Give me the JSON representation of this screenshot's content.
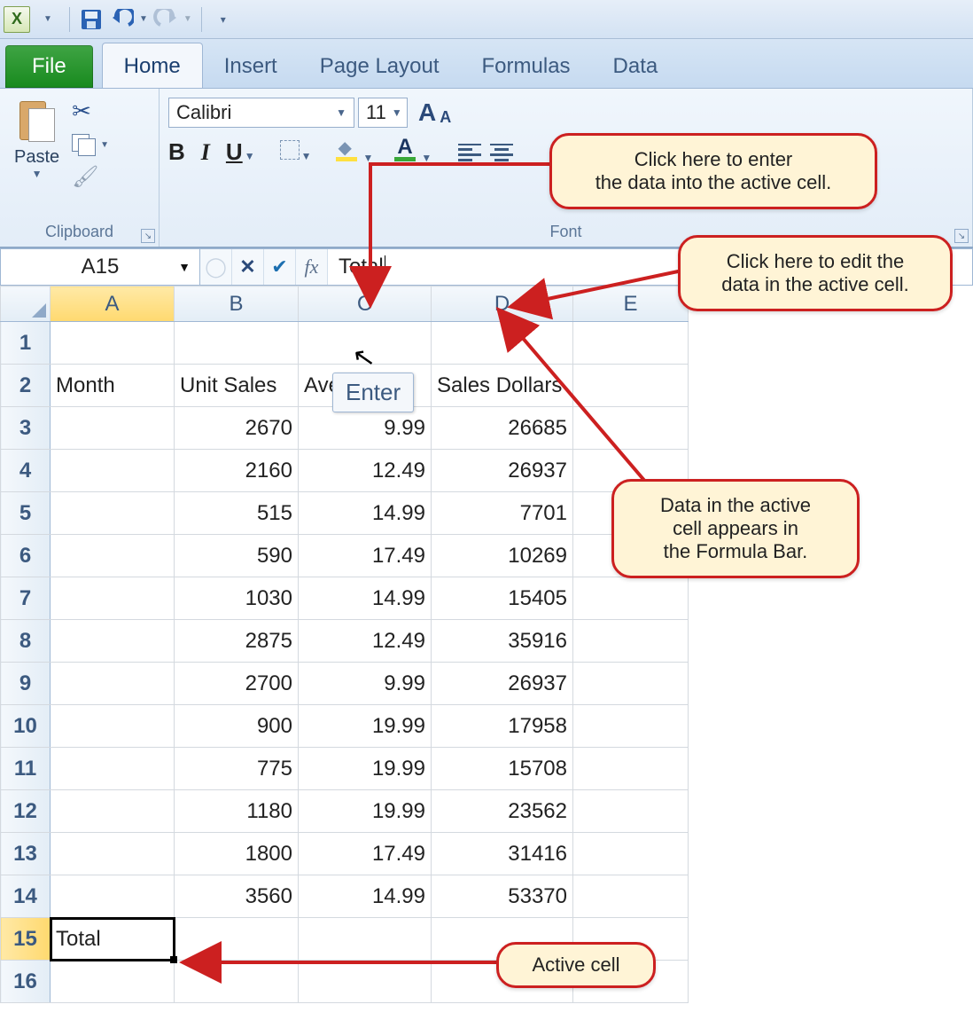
{
  "qat": {
    "app_letter": "X"
  },
  "tabs": {
    "file": "File",
    "items": [
      "Home",
      "Insert",
      "Page Layout",
      "Formulas",
      "Data"
    ],
    "active_index": 0
  },
  "ribbon": {
    "clipboard": {
      "paste": "Paste",
      "group": "Clipboard"
    },
    "font": {
      "name": "Calibri",
      "size": "11",
      "group": "Font",
      "bold": "B",
      "italic": "I",
      "underline": "U"
    }
  },
  "formula_bar": {
    "name_box": "A15",
    "content": "Total",
    "fx": "fx"
  },
  "enter_tooltip": "Enter",
  "columns": [
    "A",
    "B",
    "C",
    "D",
    "E"
  ],
  "row_headers": [
    1,
    2,
    3,
    4,
    5,
    6,
    7,
    8,
    9,
    10,
    11,
    12,
    13,
    14,
    15,
    16
  ],
  "headers_row": {
    "A": "Month",
    "B": "Unit Sales",
    "C": "Average P",
    "D": "Sales Dollars"
  },
  "data_rows": [
    {
      "B": 2670,
      "C": 9.99,
      "D": 26685
    },
    {
      "B": 2160,
      "C": 12.49,
      "D": 26937
    },
    {
      "B": 515,
      "C": 14.99,
      "D": 7701
    },
    {
      "B": 590,
      "C": 17.49,
      "D": 10269
    },
    {
      "B": 1030,
      "C": 14.99,
      "D": 15405
    },
    {
      "B": 2875,
      "C": 12.49,
      "D": 35916
    },
    {
      "B": 2700,
      "C": 9.99,
      "D": 26937
    },
    {
      "B": 900,
      "C": 19.99,
      "D": 17958
    },
    {
      "B": 775,
      "C": 19.99,
      "D": 15708
    },
    {
      "B": 1180,
      "C": 19.99,
      "D": 23562
    },
    {
      "B": 1800,
      "C": 17.49,
      "D": 31416
    },
    {
      "B": 3560,
      "C": 14.99,
      "D": 53370
    }
  ],
  "active_cell": {
    "row": 15,
    "col": "A",
    "value": "Total"
  },
  "callouts": {
    "enter_data": "Click here to enter\nthe data into the active cell.",
    "edit_data": "Click here to edit the\ndata in the active cell.",
    "in_formula_bar": "Data in the active\ncell appears in\nthe Formula Bar.",
    "active_cell": "Active cell"
  }
}
